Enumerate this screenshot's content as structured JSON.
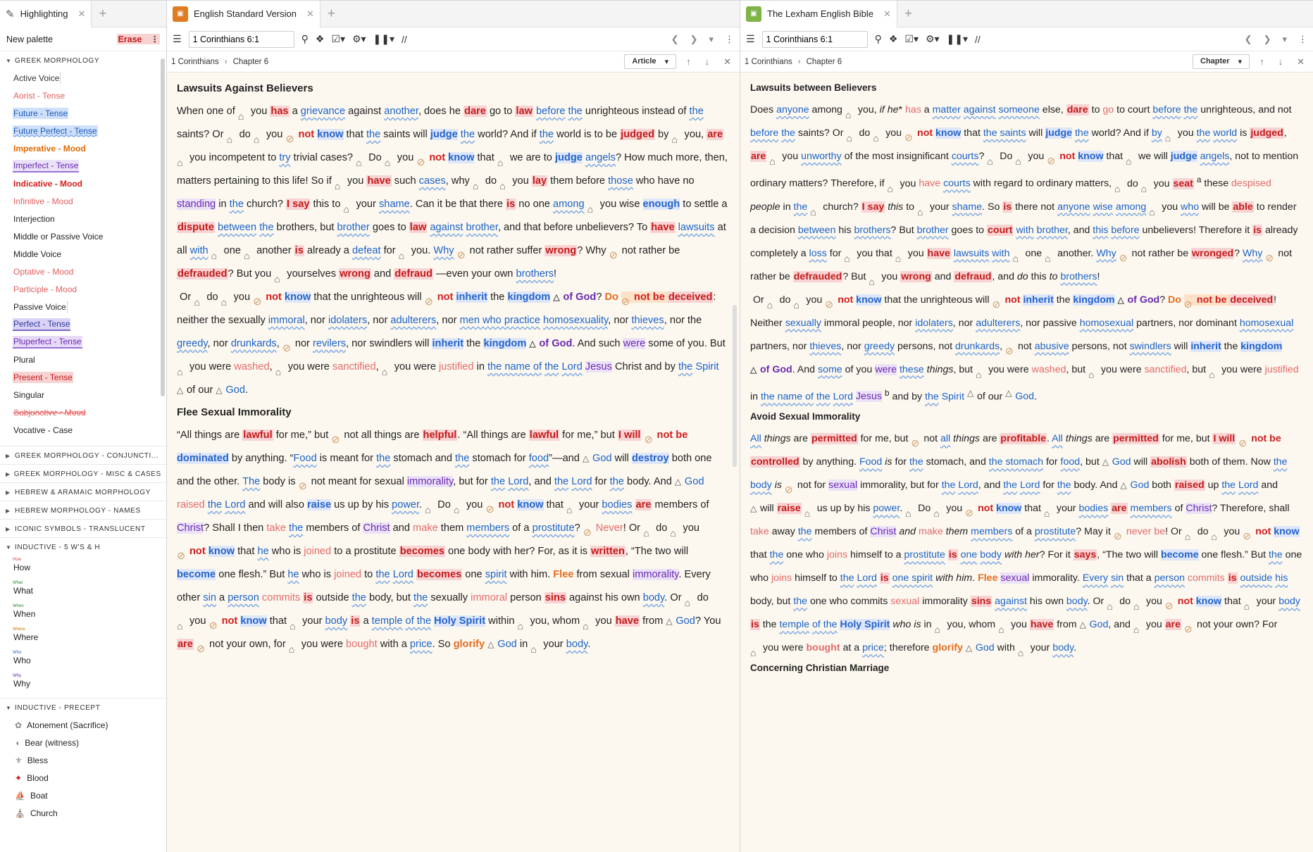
{
  "highlight_panel": {
    "tab_title": "Highlighting",
    "new_palette": "New palette",
    "erase": "Erase",
    "greek_morphology_header": "GREEK MORPHOLOGY",
    "greek_items": [
      "Active Voice",
      "Aorist - Tense",
      "Future - Tense",
      "Future Perfect - Tense",
      "Imperative - Mood",
      "Imperfect - Tense",
      "Indicative - Mood",
      "Infinitive - Mood",
      "Interjection",
      "Middle or Passive Voice",
      "Middle Voice",
      "Optative - Mood",
      "Participle - Mood",
      "Passive Voice",
      "Perfect - Tense",
      "Pluperfect - Tense",
      "Plural",
      "Present - Tense",
      "Singular",
      "Subjunctive - Mood",
      "Vocative - Case"
    ],
    "collapsed_sections": [
      "GREEK MORPHOLOGY - CONJUNCTI...",
      "GREEK MORPHOLOGY - MISC & CASES",
      "HEBREW & ARAMAIC MORPHOLOGY",
      "HEBREW MORPHOLOGY - NAMES",
      "ICONIC SYMBOLS - TRANSLUCENT"
    ],
    "inductive_header": "INDUCTIVE - 5 W'S & H",
    "inductive_items": [
      {
        "tag": "How",
        "label": "How"
      },
      {
        "tag": "What",
        "label": "What"
      },
      {
        "tag": "When",
        "label": "When"
      },
      {
        "tag": "Where",
        "label": "Where"
      },
      {
        "tag": "Who",
        "label": "Who"
      },
      {
        "tag": "Why",
        "label": "Why"
      }
    ],
    "precept_header": "INDUCTIVE - PRECEPT",
    "precept_items": [
      "Atonement (Sacrifice)",
      "Bear (witness)",
      "Bless",
      "Blood",
      "Boat",
      "Church"
    ]
  },
  "esv": {
    "tab_title": "English Standard Version",
    "reference": "1 Corinthians 6:1",
    "breadcrumb_book": "1 Corinthians",
    "breadcrumb_chapter": "Chapter 6",
    "mode": "Article",
    "heading1": "Lawsuits Against Believers",
    "heading2": "Flee Sexual Immorality"
  },
  "lexham": {
    "tab_title": "The Lexham English Bible",
    "reference": "1 Corinthians 6:1",
    "breadcrumb_book": "1 Corinthians",
    "breadcrumb_chapter": "Chapter 6",
    "mode": "Chapter",
    "heading1": "Lawsuits between Believers",
    "heading2": "Avoid Sexual Immorality",
    "heading3_partial": "Concerning Christian Marriage"
  }
}
